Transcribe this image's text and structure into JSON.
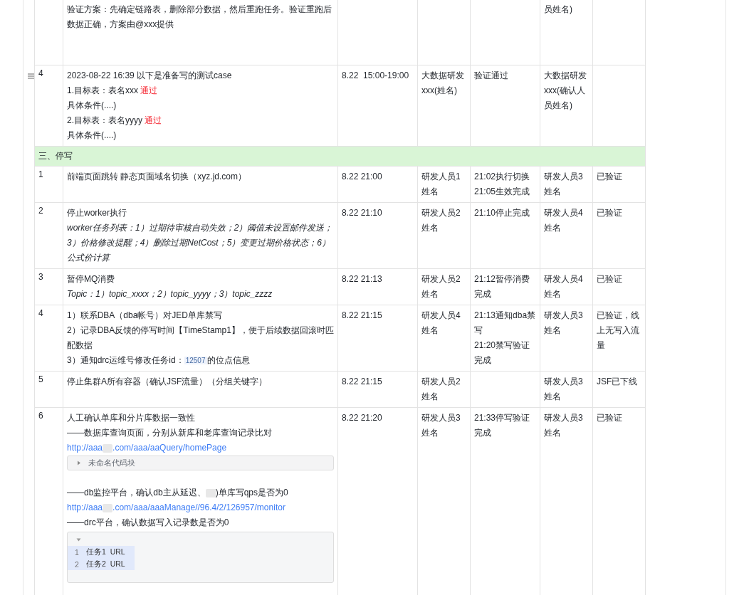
{
  "table": {
    "rows": [
      {
        "kind": "cut",
        "handle": false,
        "content": [
          {
            "kind": "text",
            "text": "验证方案：先确定链路表，删除部分数据，然后重跑任务。验证重跑后数据正确，方案由@xxx提供"
          }
        ],
        "confirmer": [
          "员姓名)"
        ]
      },
      {
        "kind": "row",
        "handle": true,
        "number": "4",
        "content": [
          {
            "kind": "text",
            "text": "2023-08-22 16:39 以下是准备写的测试case"
          },
          {
            "kind": "text",
            "segments": [
              {
                "kind": "text",
                "text": "1.目标表：表名xxx "
              },
              {
                "kind": "pass",
                "text": "通过"
              }
            ]
          },
          {
            "kind": "text",
            "text": "具体条件(....)"
          },
          {
            "kind": "text",
            "segments": [
              {
                "kind": "text",
                "text": "2.目标表：表名yyyy "
              },
              {
                "kind": "pass",
                "text": "通过"
              }
            ]
          },
          {
            "kind": "text",
            "text": "具体条件(....)"
          }
        ],
        "time": [
          "8.22  15:00-19:00"
        ],
        "owner": [
          "大数据研发xxx(姓名)"
        ],
        "result": [
          "验证通过"
        ],
        "confirmer": [
          "大数据研发xxx(确认人员姓名)"
        ]
      },
      {
        "kind": "section",
        "handle": false,
        "title": "三、停写"
      },
      {
        "kind": "row",
        "handle": false,
        "number": "1",
        "content": [
          {
            "kind": "text",
            "text": "前端页面跳转 静态页面域名切换（xyz.jd.com）"
          }
        ],
        "time": [
          "8.22 21:00"
        ],
        "owner": [
          "研发人员1姓名"
        ],
        "result": [
          "21:02执行切换",
          "21:05生效完成"
        ],
        "confirmer": [
          "研发人员3姓名"
        ],
        "status": [
          "已验证"
        ]
      },
      {
        "kind": "row",
        "handle": false,
        "number": "2",
        "content": [
          {
            "kind": "text",
            "text": "停止worker执行"
          },
          {
            "kind": "italic",
            "text": "worker任务列表：1）过期待审核自动失效；2）阈值未设置邮件发送；3）价格修改提醒；4）删除过期NetCost；5）变更过期价格状态；6）公式价计算"
          }
        ],
        "time": [
          "8.22 21:10"
        ],
        "owner": [
          "研发人员2姓名"
        ],
        "result": [
          "21:10停止完成"
        ],
        "confirmer": [
          "研发人员4姓名"
        ],
        "status": [
          "已验证"
        ]
      },
      {
        "kind": "row",
        "handle": false,
        "number": "3",
        "content": [
          {
            "kind": "text",
            "text": "暂停MQ消费"
          },
          {
            "kind": "italic",
            "text": "Topic：1）topic_xxxx；2）topic_yyyy；3）topic_zzzz"
          }
        ],
        "time": [
          "8.22 21:13"
        ],
        "owner": [
          "研发人员2姓名"
        ],
        "result": [
          "21:12暂停消费完成"
        ],
        "confirmer": [
          "研发人员4姓名"
        ],
        "status": [
          "已验证"
        ]
      },
      {
        "kind": "row",
        "handle": false,
        "number": "4",
        "content": [
          {
            "kind": "text",
            "text": "1）联系DBA（dba帐号）对JED单库禁写"
          },
          {
            "kind": "text",
            "text": "2）记录DBA反馈的停写时间【TimeStamp1】，便于后续数据回滚时匹配数据"
          },
          {
            "kind": "text",
            "segments": [
              {
                "kind": "text",
                "text": "3）通知drc运维号修改任务id："
              },
              {
                "kind": "chip",
                "text": "12507"
              },
              {
                "kind": "text",
                "text": "的位点信息"
              }
            ]
          }
        ],
        "time": [
          "8.22 21:15"
        ],
        "owner": [
          "研发人员4姓名"
        ],
        "result": [
          "21:13通知dba禁写",
          "21:20禁写验证完成"
        ],
        "confirmer": [
          "研发人员3姓名"
        ],
        "status": [
          "已验证，线上无写入流量"
        ]
      },
      {
        "kind": "row",
        "handle": false,
        "number": "5",
        "content": [
          {
            "kind": "text",
            "text": "停止集群A所有容器（确认JSF流量）（分组关键字）"
          }
        ],
        "time": [
          "8.22 21:15"
        ],
        "owner": [
          "研发人员2姓名"
        ],
        "confirmer": [
          "研发人员3姓名"
        ],
        "status": [
          "JSF已下线"
        ]
      },
      {
        "kind": "row",
        "handle": false,
        "number": "6",
        "content": [
          {
            "kind": "text",
            "text": "人工确认单库和分片库数据一致性"
          },
          {
            "kind": "text",
            "text": "——数据库查询页面，分别从新库和老库查询记录比对"
          },
          {
            "kind": "link",
            "segments": [
              {
                "kind": "text",
                "text": "http://aaa"
              },
              {
                "kind": "redaction"
              },
              {
                "kind": "text",
                "text": ".com/aaa/aaQuery/homePage"
              }
            ]
          },
          {
            "kind": "code",
            "expanded": false,
            "title": "未命名代码块"
          },
          {
            "kind": "blank"
          },
          {
            "kind": "text",
            "segments": [
              {
                "kind": "text",
                "text": "——db监控平台，确认db主从延迟、"
              },
              {
                "kind": "redaction"
              },
              {
                "kind": "text",
                "text": ")单库写qps是否为0"
              }
            ]
          },
          {
            "kind": "link",
            "segments": [
              {
                "kind": "text",
                "text": "http://aaa"
              },
              {
                "kind": "redaction"
              },
              {
                "kind": "text",
                "text": ".com/aaa/aaaManage//96.4/2/126957/monitor"
              }
            ]
          },
          {
            "kind": "text",
            "text": "——drc平台，确认数据写入记录数是否为0"
          },
          {
            "kind": "code",
            "expanded": true,
            "lines": [
              {
                "num": "1",
                "text": "任务1  URL",
                "selected": true
              },
              {
                "num": "2",
                "text": "任务2  URL",
                "selected": true
              }
            ]
          }
        ],
        "time": [
          "8.22 21:20"
        ],
        "owner": [
          "研发人员3姓名"
        ],
        "result": [
          "21:33停写验证完成"
        ],
        "confirmer": [
          "研发人员3姓名"
        ],
        "status": [
          "已验证"
        ]
      }
    ]
  }
}
